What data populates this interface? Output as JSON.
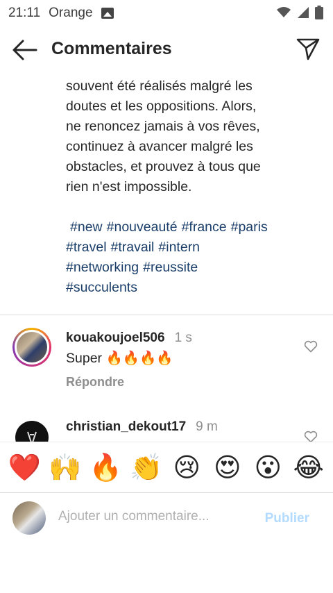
{
  "status_bar": {
    "time": "21:11",
    "carrier": "Orange",
    "icons": [
      "image-icon",
      "wifi-icon",
      "signal-icon",
      "battery-icon"
    ]
  },
  "header": {
    "title": "Commentaires",
    "back_icon": "arrow-left-icon",
    "send_icon": "paper-plane-icon"
  },
  "caption": {
    "lines": [
      "souvent été réalisés malgré les",
      "doutes et les oppositions. Alors,",
      "ne renoncez jamais à vos rêves,",
      "continuez à avancer malgré les",
      "obstacles, et prouvez à tous que",
      "rien n'est impossible."
    ],
    "hashtags": [
      "#new",
      "#nouveauté",
      "#france",
      "#paris",
      "#travel",
      "#travail",
      "#intern",
      "#networking",
      "#reussite",
      "#succulents"
    ]
  },
  "comments": [
    {
      "username": "kouakoujoel506",
      "time": "1 s",
      "text": "Super 🔥🔥🔥🔥",
      "reply_label": "Répondre"
    },
    {
      "username": "christian_dekout17",
      "time": "9 m"
    }
  ],
  "emoji_bar": [
    "❤️",
    "🙌",
    "🔥",
    "👏",
    "😢",
    "😍",
    "😮",
    "😂"
  ],
  "comment_input": {
    "placeholder": "Ajouter un commentaire...",
    "publish_label": "Publier"
  },
  "colors": {
    "hashtag": "#1a3e69",
    "publish_disabled": "#b3dbff",
    "muted": "#8e8e8e"
  }
}
